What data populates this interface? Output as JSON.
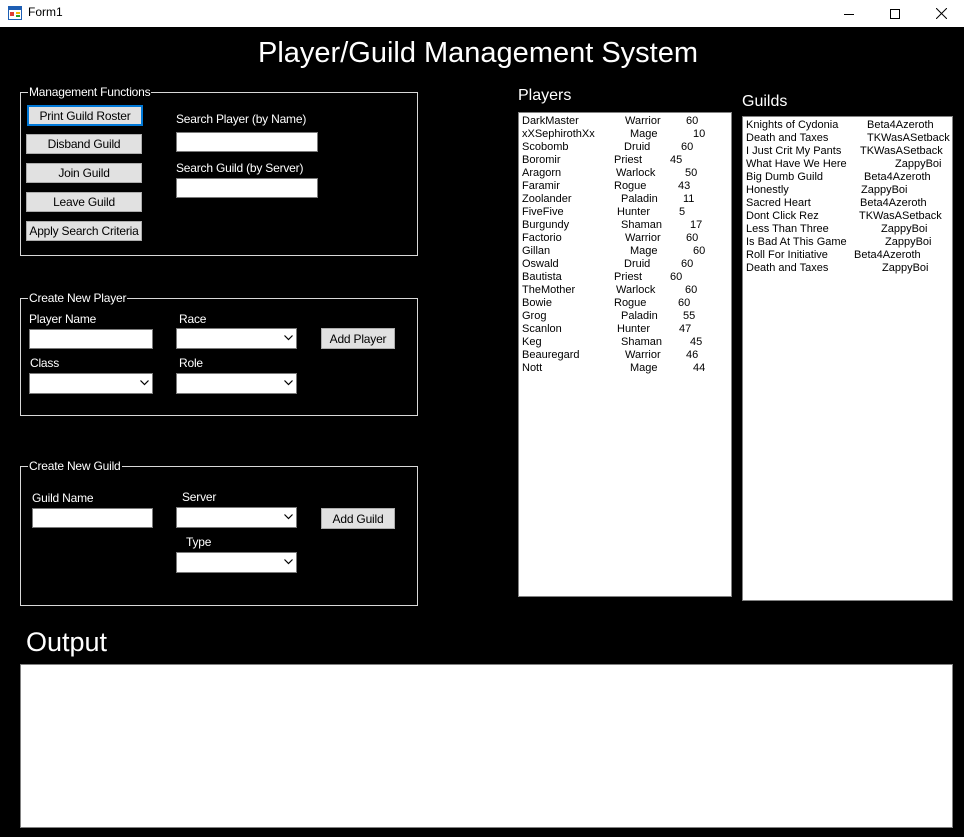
{
  "window": {
    "title": "Form1"
  },
  "header": {
    "title": "Player/Guild Management System"
  },
  "management": {
    "title": "Management Functions",
    "buttons": {
      "print_roster": "Print Guild Roster",
      "disband": "Disband Guild",
      "join": "Join Guild",
      "leave": "Leave Guild",
      "apply": "Apply Search Criteria"
    },
    "search_player_label": "Search Player (by Name)",
    "search_player_value": "",
    "search_guild_label": "Search Guild (by Server)",
    "search_guild_value": ""
  },
  "new_player": {
    "title": "Create New Player",
    "name_label": "Player Name",
    "name_value": "",
    "race_label": "Race",
    "race_value": "",
    "class_label": "Class",
    "class_value": "",
    "role_label": "Role",
    "role_value": "",
    "add_button": "Add Player"
  },
  "new_guild": {
    "title": "Create New Guild",
    "name_label": "Guild Name",
    "name_value": "",
    "server_label": "Server",
    "server_value": "",
    "type_label": "Type",
    "type_value": "",
    "add_button": "Add Guild"
  },
  "players": {
    "title": "Players",
    "rows": [
      {
        "name": "DarkMaster",
        "cls": "Warrior",
        "level": "60"
      },
      {
        "name": "xXSephirothXx",
        "cls": "Mage",
        "level": "10"
      },
      {
        "name": "Scobomb",
        "cls": "Druid",
        "level": "60"
      },
      {
        "name": "Boromir",
        "cls": "Priest",
        "level": "45"
      },
      {
        "name": "Aragorn",
        "cls": "Warlock",
        "level": "50"
      },
      {
        "name": "Faramir",
        "cls": "Rogue",
        "level": "43"
      },
      {
        "name": "Zoolander",
        "cls": "Paladin",
        "level": "11"
      },
      {
        "name": "FiveFive",
        "cls": "Hunter",
        "level": "5"
      },
      {
        "name": "Burgundy",
        "cls": "Shaman",
        "level": "17"
      },
      {
        "name": "Factorio",
        "cls": "Warrior",
        "level": "60"
      },
      {
        "name": "Gillan",
        "cls": "Mage",
        "level": "60"
      },
      {
        "name": "Oswald",
        "cls": "Druid",
        "level": "60"
      },
      {
        "name": "Bautista",
        "cls": "Priest",
        "level": "60"
      },
      {
        "name": "TheMother",
        "cls": "Warlock",
        "level": "60"
      },
      {
        "name": "Bowie",
        "cls": "Rogue",
        "level": "60"
      },
      {
        "name": "Grog",
        "cls": "Paladin",
        "level": "55"
      },
      {
        "name": "Scanlon",
        "cls": "Hunter",
        "level": "47"
      },
      {
        "name": "Keg",
        "cls": "Shaman",
        "level": "45"
      },
      {
        "name": "Beauregard",
        "cls": "Warrior",
        "level": "46"
      },
      {
        "name": "Nott",
        "cls": "Mage",
        "level": "44"
      }
    ]
  },
  "guilds": {
    "title": "Guilds",
    "rows": [
      {
        "name": "Knights of Cydonia",
        "server": "Beta4Azeroth"
      },
      {
        "name": "Death and Taxes",
        "server": "TKWasASetback"
      },
      {
        "name": "I Just Crit My Pants",
        "server": "TKWasASetback"
      },
      {
        "name": "What Have We Here",
        "server": "ZappyBoi"
      },
      {
        "name": "Big Dumb Guild",
        "server": "Beta4Azeroth"
      },
      {
        "name": "Honestly",
        "server": "ZappyBoi"
      },
      {
        "name": "Sacred Heart",
        "server": "Beta4Azeroth"
      },
      {
        "name": "Dont Click Rez",
        "server": "TKWasASetback"
      },
      {
        "name": "Less Than Three",
        "server": "ZappyBoi"
      },
      {
        "name": "Is Bad At This Game",
        "server": "ZappyBoi"
      },
      {
        "name": "Roll For Initiative",
        "server": "Beta4Azeroth"
      },
      {
        "name": "Death and Taxes",
        "server": "ZappyBoi"
      }
    ]
  },
  "output": {
    "title": "Output",
    "text": ""
  }
}
